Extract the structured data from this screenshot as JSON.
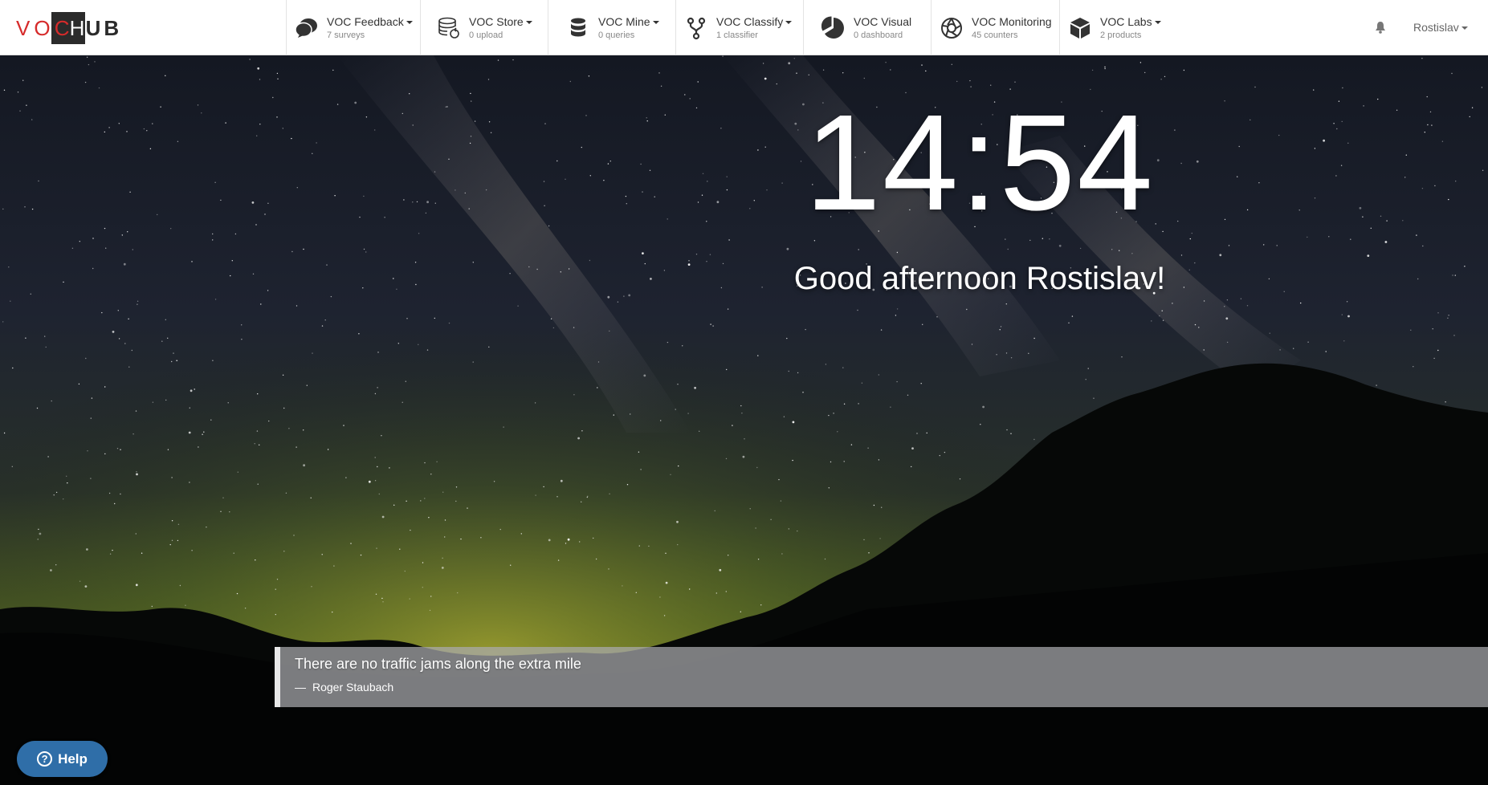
{
  "logo": {
    "part1": "VO",
    "part2": "C",
    "part3": "H",
    "part4": "UB"
  },
  "nav": [
    {
      "title": "VOC Feedback",
      "sub": "7 surveys",
      "icon": "chat-bubbles-icon",
      "dropdown": true
    },
    {
      "title": "VOC Store",
      "sub": "0 upload",
      "icon": "database-refresh-icon",
      "dropdown": true
    },
    {
      "title": "VOC Mine",
      "sub": "0 queries",
      "icon": "database-icon",
      "dropdown": true
    },
    {
      "title": "VOC Classify",
      "sub": "1 classifier",
      "icon": "fork-icon",
      "dropdown": true
    },
    {
      "title": "VOC Visual",
      "sub": "0 dashboard",
      "icon": "pie-chart-icon",
      "dropdown": false
    },
    {
      "title": "VOC Monitoring",
      "sub": "45 counters",
      "icon": "aperture-icon",
      "dropdown": false
    },
    {
      "title": "VOC Labs",
      "sub": "2 products",
      "icon": "cube-icon",
      "dropdown": true
    }
  ],
  "user": {
    "name": "Rostislav",
    "bell_icon": "bell-icon"
  },
  "clock": {
    "time": "14:54"
  },
  "greeting": "Good afternoon Rostislav!",
  "quote": {
    "text": "There are no traffic jams along the extra mile",
    "dash": "—",
    "author": "Roger Staubach"
  },
  "help": {
    "label": "Help",
    "icon_glyph": "?"
  },
  "colors": {
    "brand_red": "#d62b2b",
    "help_blue": "#2f6ea8",
    "nav_bg": "#ffffff"
  }
}
